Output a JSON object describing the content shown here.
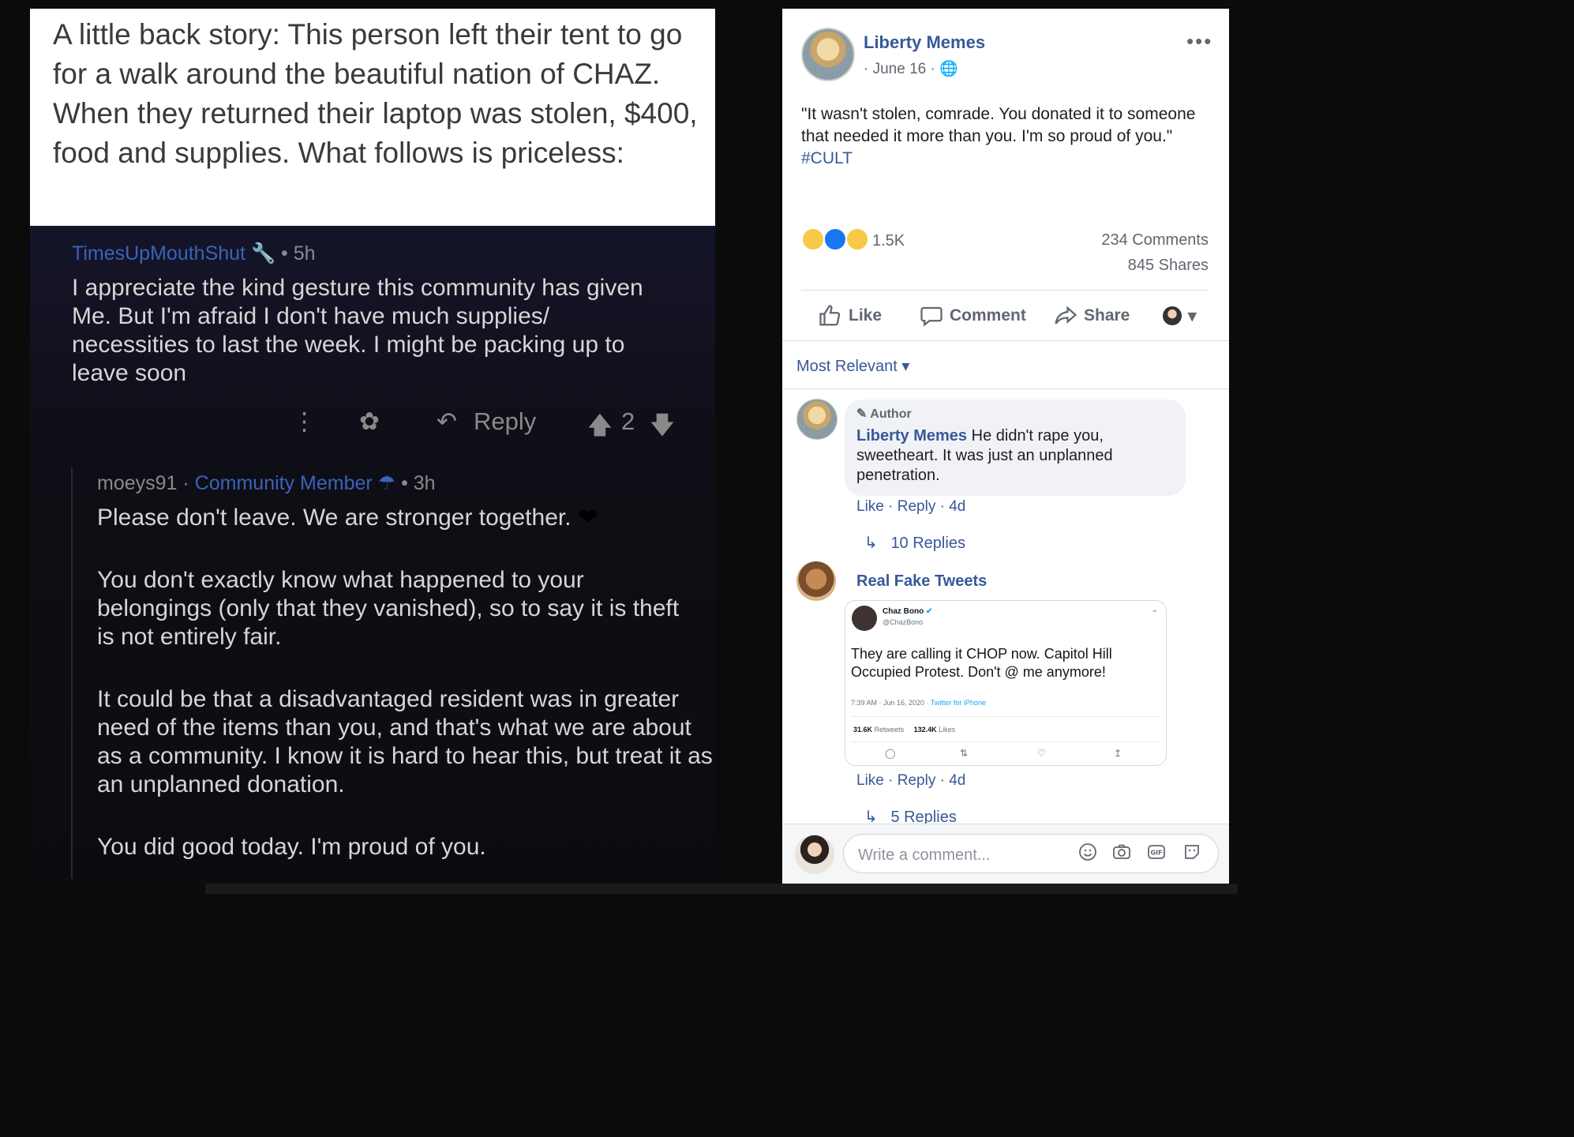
{
  "left_screenshot": {
    "caption": "A little back story: This person left their tent to go for a walk around the beautiful nation of CHAZ. When they returned their laptop was stolen, $400, food and supplies. What follows is priceless:",
    "comment1": {
      "user": "TimesUpMouthShut",
      "time": "• 5h",
      "body": "I appreciate the kind gesture this community has given Me. But I'm afraid I don't have much supplies/ necessities to last the week. I might be packing up to leave soon",
      "reply_label": "Reply",
      "score": "2"
    },
    "comment2": {
      "user": "moeys91",
      "badge": "Community Member",
      "time": "• 3h",
      "p1": "Please don't leave. We are stronger together.",
      "p2": "You don't exactly know what happened to your belongings (only that they vanished), so to say it is theft is not entirely fair.",
      "p3": "It could be that a disadvantaged resident was in greater need of the items than you, and that's what we are about as a community. I know it is hard to hear this, but treat it as an unplanned donation.",
      "p4": "You did good today. I'm proud of you."
    }
  },
  "post": {
    "page_name": "Liberty Memes",
    "date": "· June 16 ·",
    "text": "\"It wasn't stolen, comrade. You donated it to someone that needed it more than you. I'm so proud of you.\"",
    "hashtag": "#CULT",
    "reaction_count": "1.5K",
    "comments_count": "234 Comments",
    "shares_count": "845 Shares",
    "actions": {
      "like": "Like",
      "comment": "Comment",
      "share": "Share"
    },
    "filter": "Most Relevant"
  },
  "comments": [
    {
      "badge": "Author",
      "name": "Liberty Memes",
      "text": "He didn't rape you, sweetheart. It was just an unplanned penetration.",
      "actions": "Like · Reply · 4d",
      "replies": "10 Replies"
    },
    {
      "name": "Real Fake Tweets",
      "actions": "Like · Reply · 4d",
      "replies": "5 Replies",
      "tweet": {
        "name": "Chaz Bono",
        "handle": "@ChazBono",
        "text": "They are calling it CHOP now. Capitol Hill Occupied Protest. Don't @ me anymore!",
        "time": "7:39 AM · Jun 16, 2020 ·",
        "client": "Twitter for iPhone",
        "retweets": "31.6K",
        "retweets_label": "Retweets",
        "likes": "132.4K",
        "likes_label": "Likes"
      }
    }
  ],
  "composer": {
    "placeholder": "Write a comment..."
  },
  "colors": {
    "fb_link": "#385898",
    "reddit_user": "#3a63b8",
    "twitter_blue": "#1da1f2"
  }
}
